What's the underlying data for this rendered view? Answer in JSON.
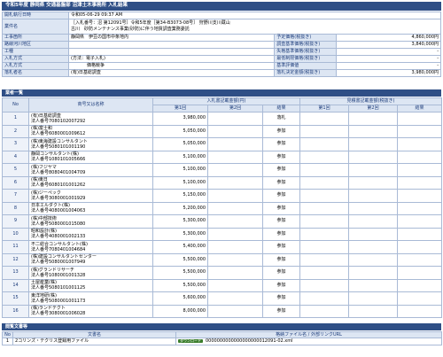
{
  "header": {
    "title": "令和5年度 静岡県 交通基盤部 沼津土木事務所 入札結果"
  },
  "info": {
    "rows": [
      {
        "label": "開札執行日時",
        "value": "令和05-06-29 09:37 AM"
      },
      {
        "label": "業件名",
        "value_lines": [
          "［入札番号：沼 第12091号］令和5年度［第34-B3073-08号］ 狩野川支川蔵山",
          "古川　砂防メンテナンス事業(砂防)に伴う地質調査業務委託"
        ]
      },
      {
        "label": "工事箇所",
        "value": "静岡県　伊豆の国市中条地内",
        "label2": "予定価格(税抜き)",
        "value2": "4,860,000円"
      },
      {
        "label": "路線河川地区",
        "value": "",
        "label2": "調査基準価格(税抜き)",
        "value2": "3,840,000円"
      },
      {
        "label": "工種",
        "value": "",
        "label2": "失格基準価格(税抜き)",
        "value2": "-"
      },
      {
        "label": "入札方式",
        "value": "(方法：電子入札)",
        "label2": "最低制限価格(税抜き)",
        "value2": "-"
      },
      {
        "label": "入札方式",
        "value": "価格競争",
        "label2": "基準評価値",
        "value2": "-"
      },
      {
        "label": "落札者名",
        "value": "(有)日基総調査",
        "label2": "落札決定金額(税抜き)",
        "value2": "3,980,000円"
      }
    ]
  },
  "bidders_section": {
    "title": "業者一覧"
  },
  "table": {
    "col_no": "No",
    "col_name": "商号又は名称",
    "col_bid_group": "入札書記載金額(円)",
    "col_lowest_group": "見積書記載金額(税抜き)",
    "col_round1": "第1回",
    "col_round2": "第2回",
    "col_result": "結果",
    "rows": [
      {
        "no": "1",
        "name": "(有)日基総調査",
        "corp": "法人番号7080102007292",
        "amount": "3,980,000",
        "result": "落札"
      },
      {
        "no": "2",
        "name": "(株)富士和",
        "corp": "法人番号6080001009612",
        "amount": "5,050,000",
        "result": "参加"
      },
      {
        "no": "3",
        "name": "(株)東海建設コンサルタント",
        "corp": "法人番号5080101001190",
        "amount": "5,050,000",
        "result": "参加"
      },
      {
        "no": "4",
        "name": "静岡コンサルタント(株)",
        "corp": "法人番号1080101005666",
        "amount": "5,100,000",
        "result": "参加"
      },
      {
        "no": "5",
        "name": "(株)フジヤマ",
        "corp": "法人番号8080401004709",
        "amount": "5,100,000",
        "result": "参加"
      },
      {
        "no": "6",
        "name": "(株)東日",
        "corp": "法人番号6080101001262",
        "amount": "5,100,000",
        "result": "参加"
      },
      {
        "no": "7",
        "name": "(株)ジーペック",
        "corp": "法人番号3080001001929",
        "amount": "5,150,000",
        "result": "参加"
      },
      {
        "no": "8",
        "name": "日本エルダクト(株)",
        "corp": "法人番号4080001004063",
        "amount": "5,200,000",
        "result": "参加"
      },
      {
        "no": "9",
        "name": "(株)中部技術",
        "corp": "法人番号5080001015080",
        "amount": "5,300,000",
        "result": "参加"
      },
      {
        "no": "10",
        "name": "昭和設計(株)",
        "corp": "法人番号4080001002133",
        "amount": "5,300,000",
        "result": "参加"
      },
      {
        "no": "11",
        "name": "不二総合コンサルタント(株)",
        "corp": "法人番号7080401004684",
        "amount": "5,400,000",
        "result": "参加"
      },
      {
        "no": "12",
        "name": "(株)建設コンサルタントセンター",
        "corp": "法人番号5080001007949",
        "amount": "5,500,000",
        "result": "参加"
      },
      {
        "no": "13",
        "name": "(株)グランドリサーチ",
        "corp": "法人番号1080001001328",
        "amount": "5,500,000",
        "result": "参加"
      },
      {
        "no": "14",
        "name": "土屋産業(株)",
        "corp": "法人番号5080101001125",
        "amount": "5,500,000",
        "result": "参加"
      },
      {
        "no": "15",
        "name": "東洋地研(株)",
        "corp": "法人番号5080001001173",
        "amount": "5,600,000",
        "result": "参加"
      },
      {
        "no": "16",
        "name": "(株)ランドテクト",
        "corp": "法人番号3080001006028",
        "amount": "8,000,000",
        "result": "参加"
      }
    ]
  },
  "attachments_section": {
    "title": "閲覧文書等"
  },
  "attachments": {
    "col_no": "No",
    "col_doc": "文書名",
    "col_file": "格納ファイル名 / 外部リンクURL",
    "rows": [
      {
        "no": "1",
        "doc": "2コリンズ・テクリス登録用ファイル",
        "button": "ダウンロード",
        "file": "0000000000000000000012091-02.xml"
      }
    ]
  }
}
